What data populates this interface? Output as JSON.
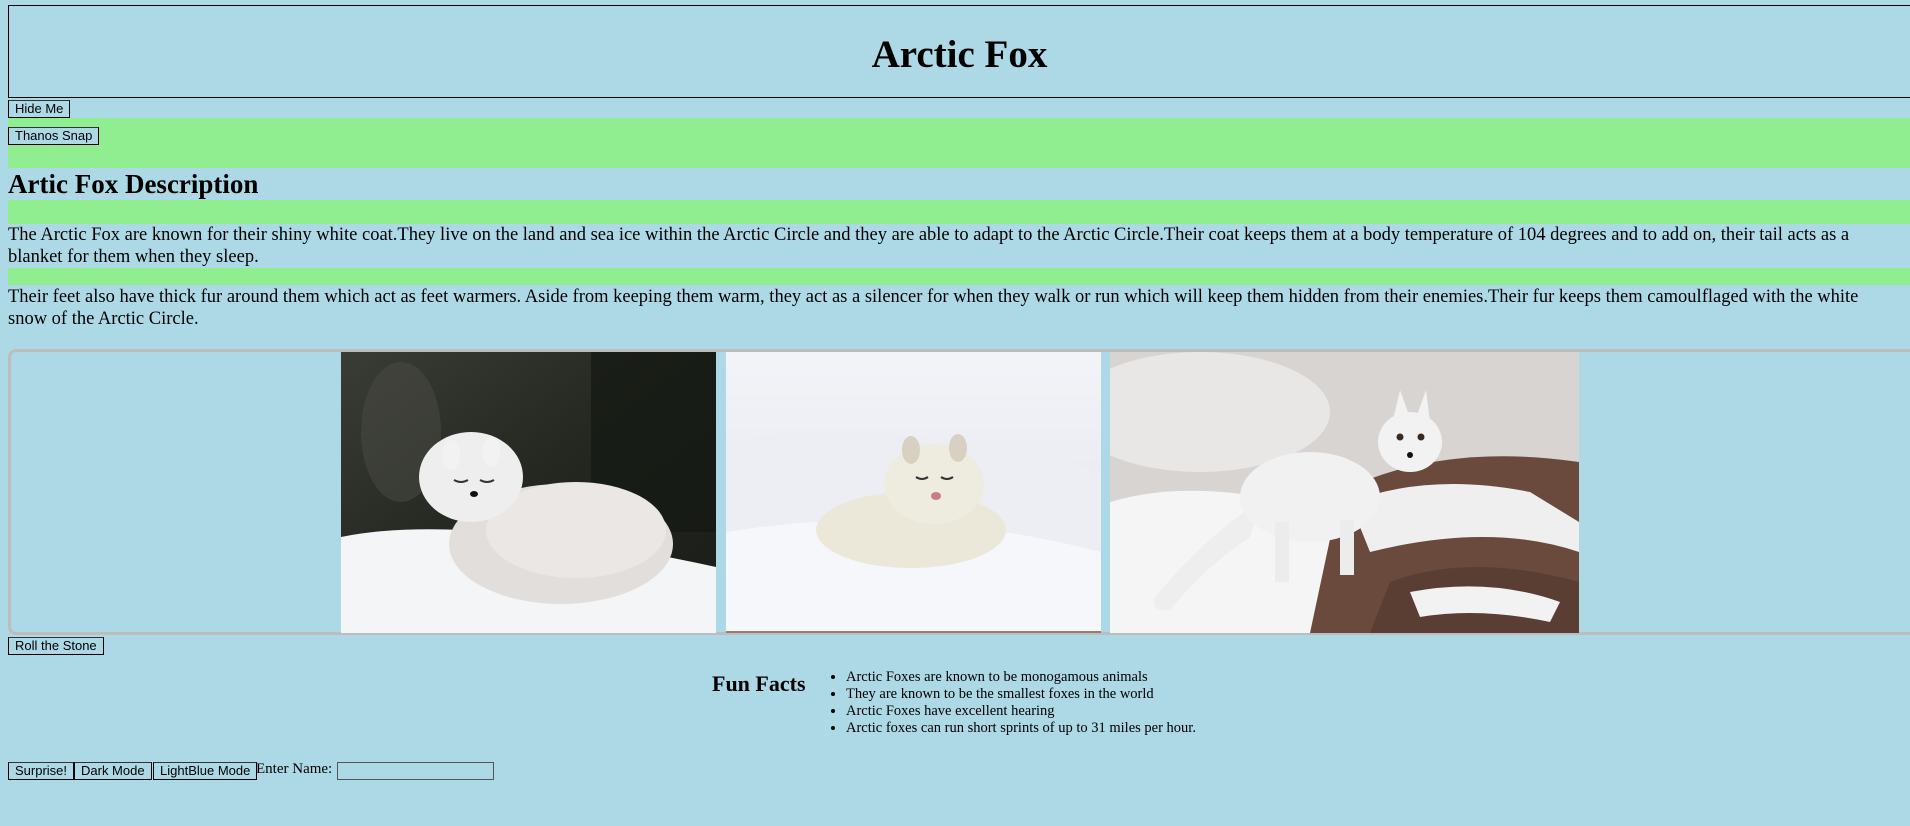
{
  "header": {
    "title": "Arctic Fox"
  },
  "buttons": {
    "hide_me": "Hide Me",
    "thanos_snap": "Thanos Snap",
    "roll_stone": "Roll the Stone",
    "surprise": "Surprise!",
    "dark_mode": "Dark Mode",
    "lightblue_mode": "LightBlue Mode"
  },
  "description": {
    "heading": "Artic Fox Description",
    "paragraphs": [
      "The Arctic Fox are known for their shiny white coat.They live on the land and sea ice within the Arctic Circle and they are able to adapt to the Arctic Circle.Their coat keeps them at a body temperature of 104 degrees and to add on, their tail acts as a blanket for them when they sleep.",
      "Their feet also have thick fur around them which act as feet warmers. Aside from keeping them warm, they act as a silencer for when they walk or run which will keep them hidden from their enemies.Their fur keeps them camoulflaged with the white snow of the Arctic Circle."
    ]
  },
  "gallery": {
    "images": [
      {
        "name": "arctic-fox-curled-photo"
      },
      {
        "name": "arctic-fox-sleeping-photo"
      },
      {
        "name": "arctic-fox-standing-photo"
      }
    ]
  },
  "fun_facts": {
    "title": "Fun Facts",
    "items": [
      "Arctic Foxes are known to be monogamous animals",
      "They are known to be the smallest foxes in the world",
      "Arctic Foxes have excellent hearing",
      "Arctic foxes can run short sprints of up to 31 miles per hour."
    ]
  },
  "name_form": {
    "label": "Enter Name:",
    "value": ""
  },
  "colors": {
    "background": "#add8e6",
    "accent_band": "#90ee90"
  }
}
